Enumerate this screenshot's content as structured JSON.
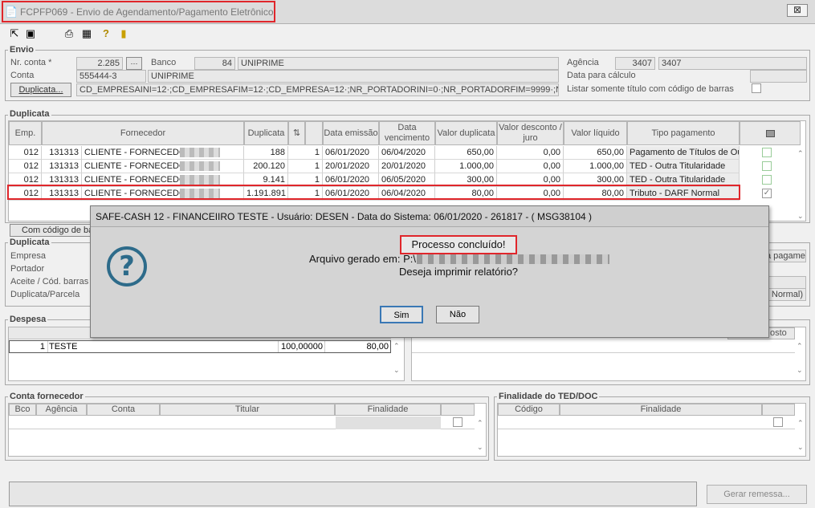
{
  "window": {
    "title": "FCPFP069 - Envio de Agendamento/Pagamento Eletrônico",
    "close": "⊠"
  },
  "toolbar": {
    "icons": [
      "arrow-icon",
      "screens-icon",
      "printer-icon",
      "calendar-icon",
      "help-icon",
      "exit-icon"
    ]
  },
  "envio": {
    "label": "Envio",
    "nr_conta_label": "Nr. conta *",
    "nr_conta_value": "2.285",
    "banco_label": "Banco",
    "banco_code": "84",
    "banco_name": "UNIPRIME",
    "agencia_label": "Agência",
    "agencia_code": "3407",
    "agencia_name": "3407",
    "conta_label": "Conta",
    "conta_value": "555444-3",
    "conta_name": "UNIPRIME",
    "data_calculo_label": "Data para cálculo",
    "duplicata_btn": "Duplicata...",
    "filter_text": "CD_EMPRESAINI=12·;CD_EMPRESAFIM=12·;CD_EMPRESA=12·;NR_PORTADORINI=0·;NR_PORTADORFIM=9999·;NR_PORTAD",
    "listar_label": "Listar somente título com código de barras"
  },
  "duplicata": {
    "label": "Duplicata",
    "headers": [
      "Emp.",
      "Fornecedor",
      "Duplicata",
      "",
      "Data emissão",
      "Data vencimento",
      "Valor duplicata",
      "Valor desconto / juro",
      "Valor líquido",
      "Tipo pagamento"
    ],
    "rows": [
      {
        "emp": "012",
        "cod": "131313",
        "forn": "CLIENTE - FORNECEDOR",
        "dup": "188",
        "parc": "1",
        "emissao": "06/01/2020",
        "venc": "06/04/2020",
        "valor": "650,00",
        "desc": "0,00",
        "liq": "650,00",
        "tipo": "Pagamento de Títulos de Ou",
        "checked": false
      },
      {
        "emp": "012",
        "cod": "131313",
        "forn": "CLIENTE - FORNECEDOR",
        "dup": "200.120",
        "parc": "1",
        "emissao": "20/01/2020",
        "venc": "20/01/2020",
        "valor": "1.000,00",
        "desc": "0,00",
        "liq": "1.000,00",
        "tipo": "TED - Outra Titularidade",
        "checked": false
      },
      {
        "emp": "012",
        "cod": "131313",
        "forn": "CLIENTE - FORNECEDOR",
        "dup": "9.141",
        "parc": "1",
        "emissao": "06/01/2020",
        "venc": "06/05/2020",
        "valor": "300,00",
        "desc": "0,00",
        "liq": "300,00",
        "tipo": "TED - Outra Titularidade",
        "checked": false
      },
      {
        "emp": "012",
        "cod": "131313",
        "forn": "CLIENTE - FORNECEDOR",
        "dup": "1.191.891",
        "parc": "1",
        "emissao": "06/01/2020",
        "venc": "06/04/2020",
        "valor": "80,00",
        "desc": "0,00",
        "liq": "80,00",
        "tipo": "Tributo - DARF Normal",
        "checked": true
      }
    ],
    "cod_barras_btn": "Com código de ba"
  },
  "detalhe": {
    "label": "Duplicata",
    "empresa": "Empresa",
    "portador": "Portador",
    "aceite": "Aceite / Cód. barras",
    "parcela": "Duplicata/Parcela",
    "right1": "a pagame",
    "right2": "Normal)"
  },
  "despesa": {
    "label": "Despesa",
    "row": {
      "num": "1",
      "desc": "TESTE",
      "pct": "100,00000",
      "valor": "80,00"
    },
    "right_hdr": "osto"
  },
  "conta_fornecedor": {
    "label": "Conta fornecedor",
    "headers": [
      "Bco",
      "Agência",
      "Conta",
      "Titular",
      "Finalidade"
    ]
  },
  "finalidade": {
    "label": "Finalidade do TED/DOC",
    "headers": [
      "Código",
      "Finalidade"
    ]
  },
  "footer": {
    "gerar_btn": "Gerar remessa..."
  },
  "dialog": {
    "title": "SAFE-CASH 12 - FINANCEIIRO TESTE - Usuário: DESEN - Data do Sistema: 06/01/2020 - 261817 - ( MSG38104 )",
    "line1": "Processo concluído!",
    "line2": "Arquivo gerado em: P:\\",
    "line3": "Deseja imprimir relatório?",
    "yes": "Sim",
    "no": "Não"
  }
}
